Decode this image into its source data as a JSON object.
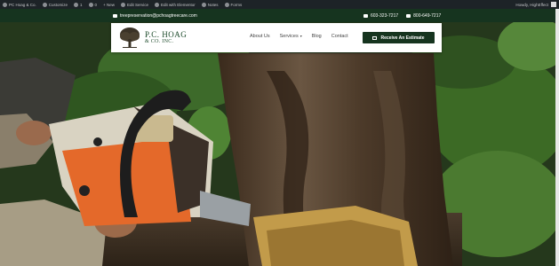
{
  "admin_bar": {
    "items": [
      "PC Hoag & Co.",
      "Customize",
      "1",
      "0",
      "+ New",
      "Edit Service",
      "Edit with Elementor",
      "Notes",
      "Forms"
    ],
    "user_label": "Howdy, HighEffect"
  },
  "header": {
    "email": "treepreservation@pchoagtreecare.com",
    "phone_1": "603-323-7217",
    "phone_2": "800-649-7217"
  },
  "logo": {
    "line1": "P.C. HOAG",
    "line2": "& CO. INC."
  },
  "nav": {
    "about": "About Us",
    "services": "Services",
    "blog": "Blog",
    "contact": "Contact",
    "cta": "Receive An Estimate"
  },
  "colors": {
    "brand_green": "#16341f",
    "admin_bar": "#1d2327"
  }
}
